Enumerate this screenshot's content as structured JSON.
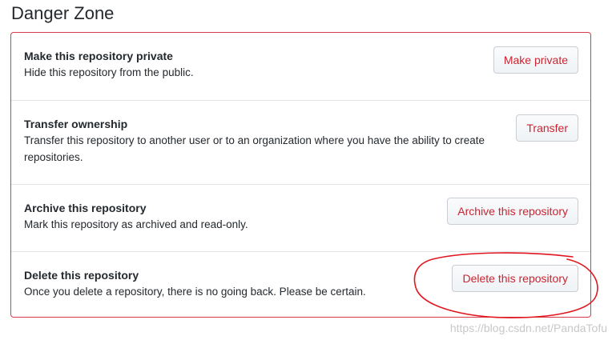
{
  "heading": "Danger Zone",
  "rows": [
    {
      "title": "Make this repository private",
      "description": "Hide this repository from the public.",
      "button": "Make private"
    },
    {
      "title": "Transfer ownership",
      "description": "Transfer this repository to another user or to an organization where you have the ability to create repositories.",
      "button": "Transfer"
    },
    {
      "title": "Archive this repository",
      "description": "Mark this repository as archived and read-only.",
      "button": "Archive this repository"
    },
    {
      "title": "Delete this repository",
      "description": "Once you delete a repository, there is no going back. Please be certain.",
      "button": "Delete this repository"
    }
  ],
  "watermark": "https://blog.csdn.net/PandaTofu",
  "colors": {
    "danger": "#cb2431",
    "border": "#d73a49",
    "annotation": "#e0161e"
  }
}
